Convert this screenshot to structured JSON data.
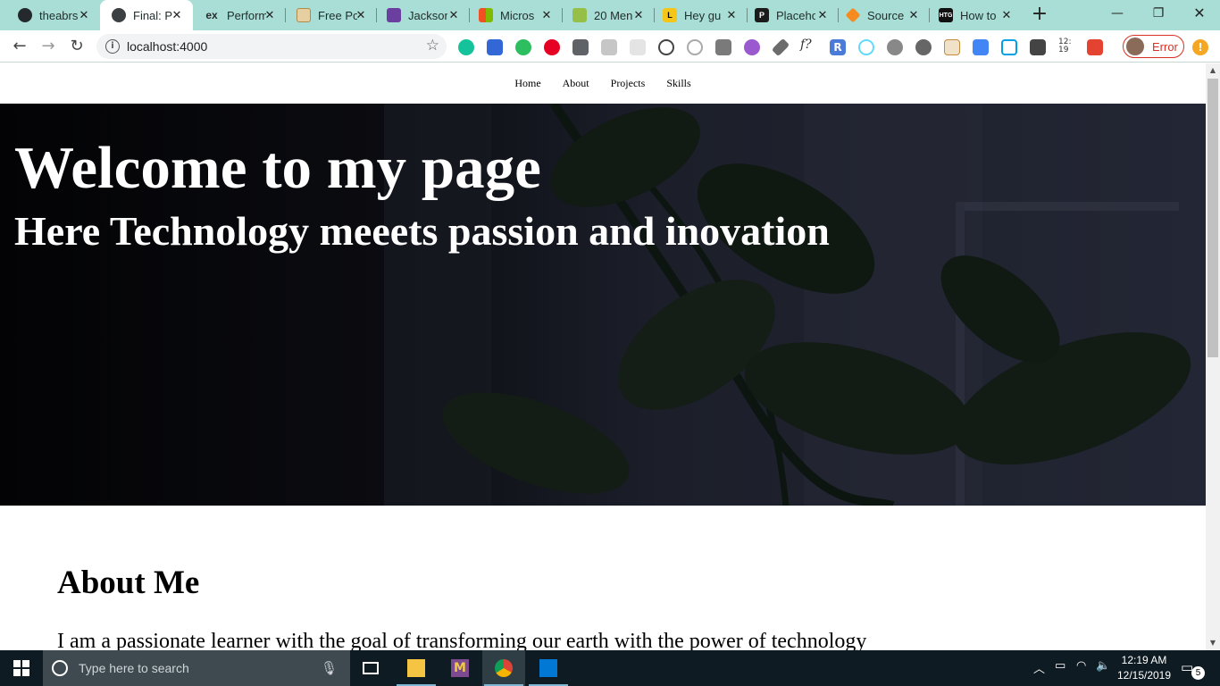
{
  "browser": {
    "tabs": [
      {
        "title": "theabrs",
        "favicon": "github-icon",
        "color": "#24292e"
      },
      {
        "title": "Final: P",
        "favicon": "globe-icon",
        "color": "#3c4043",
        "active": true
      },
      {
        "title": "Perform",
        "favicon": "ex-icon",
        "color": "#2b2b2b"
      },
      {
        "title": "Free Po",
        "favicon": "image-icon",
        "color": "#d9b77e"
      },
      {
        "title": "Jackson",
        "favicon": "colorlib-icon",
        "color": "#6b3fa0"
      },
      {
        "title": "Micros",
        "favicon": "microsoft-icon",
        "color": "#f25022"
      },
      {
        "title": "20 Men",
        "favicon": "shopify-icon",
        "color": "#95bf47"
      },
      {
        "title": "Hey gu",
        "favicon": "l-icon",
        "color": "#f5c518"
      },
      {
        "title": "Placeho",
        "favicon": "p-icon",
        "color": "#1b1b1b"
      },
      {
        "title": "Source",
        "favicon": "diamond-icon",
        "color": "#f68b1f"
      },
      {
        "title": "How to",
        "favicon": "htg-icon",
        "color": "#111111"
      }
    ],
    "new_tab": "+",
    "url": "localhost:4000",
    "profile_status": "Error"
  },
  "site": {
    "nav": [
      "Home",
      "About",
      "Projects",
      "Skills"
    ],
    "hero_title": "Welcome to my page",
    "hero_subtitle": "Here Technology meeets passion and inovation",
    "about_heading": "About Me",
    "about_text": "I am a passionate learner with the goal of transforming our earth with the power of technology"
  },
  "taskbar": {
    "search_placeholder": "Type here to search",
    "time": "12:19 AM",
    "date": "12/15/2019",
    "notification_count": "5"
  },
  "colors": {
    "tabstrip": "#a9ded6",
    "hero_bg": "#07080c",
    "taskbar": "#0f1b22",
    "error": "#d93025"
  }
}
